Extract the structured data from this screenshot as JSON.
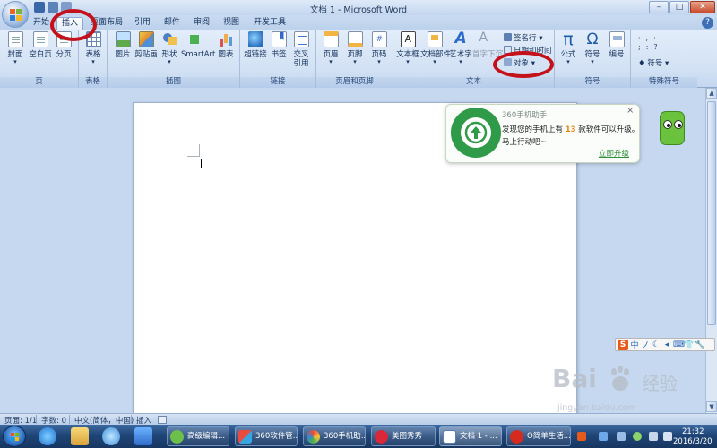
{
  "window": {
    "title": "文档 1 - Microsoft Word",
    "controls": {
      "minimize": "–",
      "maximize": "□",
      "close": "✕"
    }
  },
  "ribbon": {
    "tabs": [
      {
        "label": "开始"
      },
      {
        "label": "插入",
        "active": true
      },
      {
        "label": "页面布局"
      },
      {
        "label": "引用"
      },
      {
        "label": "邮件"
      },
      {
        "label": "审阅"
      },
      {
        "label": "视图"
      },
      {
        "label": "开发工具"
      }
    ],
    "groups": {
      "pages": {
        "label": "页",
        "buttons": [
          "封面",
          "空白页",
          "分页"
        ]
      },
      "tables": {
        "label": "表格",
        "buttons": [
          "表格"
        ]
      },
      "illustrations": {
        "label": "插图",
        "buttons": [
          "图片",
          "剪贴画",
          "形状",
          "SmartArt",
          "图表"
        ]
      },
      "links": {
        "label": "链接",
        "buttons": [
          "超链接",
          "书签",
          "交叉",
          "引用"
        ]
      },
      "header_footer": {
        "label": "页眉和页脚",
        "buttons": [
          "页眉",
          "页脚",
          "页码"
        ]
      },
      "text": {
        "label": "文本",
        "buttons": [
          "文本框",
          "文档部件",
          "艺术字",
          "首字下沉"
        ],
        "small": [
          "签名行",
          "日期和时间",
          "对象"
        ]
      },
      "symbols": {
        "label": "符号",
        "buttons": [
          "公式",
          "符号",
          "编号"
        ]
      },
      "special": {
        "label": "特殊符号",
        "small": [
          "符号"
        ]
      }
    },
    "help": "?"
  },
  "popup": {
    "title": "360手机助手",
    "message_prefix": "发现您的手机上有",
    "count": "13",
    "message_suffix": "款软件可以升级。",
    "message_line2": "马上行动吧~",
    "action": "立即升级",
    "close": "×",
    "accent": "#2f9a47"
  },
  "statusbar": {
    "page": "页面: 1/1",
    "words": "字数: 0",
    "language": "中文(简体，中国)",
    "mode": "插入"
  },
  "ime": {
    "logo": "S",
    "items": [
      "中",
      "ノ",
      "☾",
      "◂",
      "⌨",
      "👕",
      "🔧"
    ]
  },
  "taskbar": {
    "tasks": [
      {
        "label": "高级编辑..."
      },
      {
        "label": "360软件管..."
      },
      {
        "label": "360手机助..."
      },
      {
        "label": "美图秀秀"
      },
      {
        "label": "文档 1 - ...",
        "active": true
      },
      {
        "label": "O简单生活..."
      }
    ],
    "time": "21:32",
    "date": "2016/3/20"
  },
  "watermark": {
    "brand": "Bai",
    "brand2": "经验",
    "url": "jingyan.baidu.com"
  },
  "colors": {
    "annotation": "#c4111a",
    "ribbon": "#dbe6f6",
    "taskbar": "#1f4577"
  }
}
